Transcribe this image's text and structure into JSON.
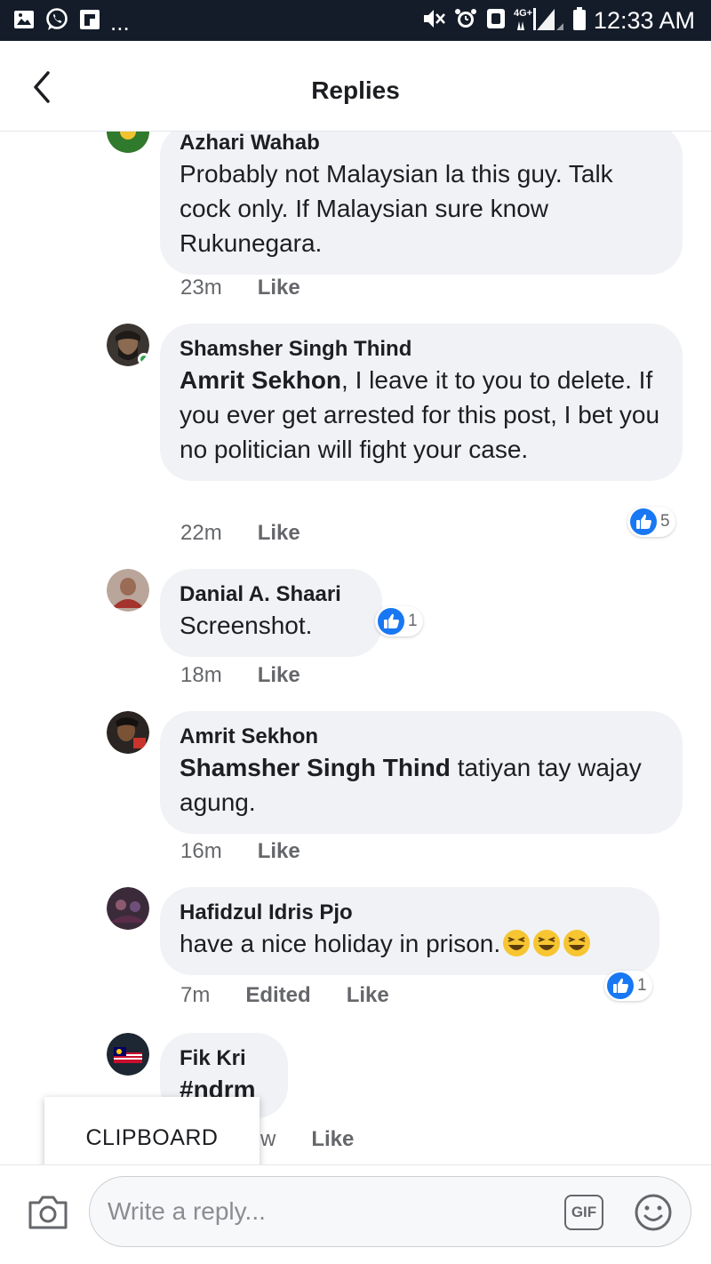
{
  "status_bar": {
    "left_icons": [
      "image-icon",
      "whatsapp-icon",
      "flipboard-icon"
    ],
    "overflow": "...",
    "right_icons": [
      "mute-icon",
      "alarm-icon",
      "nfc-icon",
      "signal-4g-icon",
      "battery-icon"
    ],
    "network_label": "4G+",
    "time": "12:33 AM"
  },
  "header": {
    "title": "Replies",
    "back_icon": "chevron-left-icon"
  },
  "comments": [
    {
      "author": "Azhari Wahab",
      "text_parts": [
        "",
        "Probably not Malaysian la this guy. Talk cock only. If Malaysian sure know Rukunegara."
      ],
      "time": "23m",
      "like_label": "Like"
    },
    {
      "author": "Shamsher Singh Thind",
      "text_parts": [
        "Amrit Sekhon",
        ", I leave it to you to delete. If you ever get arrested for this post, I bet you no politician will fight your case."
      ],
      "time": "22m",
      "like_label": "Like",
      "reaction_count": "5"
    },
    {
      "author": "Danial A. Shaari",
      "text_parts": [
        "",
        "Screenshot."
      ],
      "time": "18m",
      "like_label": "Like",
      "reaction_count": "1"
    },
    {
      "author": "Amrit Sekhon",
      "text_parts": [
        "Shamsher Singh Thind",
        " tatiyan tay wajay agung."
      ],
      "time": "16m",
      "like_label": "Like"
    },
    {
      "author": "Hafidzul Idris Pjo",
      "text_parts": [
        "",
        "have a nice holiday in prison."
      ],
      "emojis": [
        "laughing-face-icon",
        "laughing-face-icon",
        "laughing-face-icon"
      ],
      "time": "7m",
      "edited_label": "Edited",
      "like_label": "Like",
      "reaction_count": "1"
    },
    {
      "author": "Fik Kri",
      "text_parts": [
        "",
        "#ndrm"
      ],
      "time": "w",
      "like_label": "Like"
    }
  ],
  "clipboard": {
    "label": "CLIPBOARD"
  },
  "composer": {
    "placeholder": "Write a reply...",
    "gif_label": "GIF",
    "camera_icon": "camera-icon",
    "emoji_icon": "smiley-icon"
  },
  "colors": {
    "status_bar_bg": "#141c2a",
    "bubble_bg": "#f0f2f5",
    "like_blue": "#1877f2",
    "online_green": "#31a24c"
  }
}
